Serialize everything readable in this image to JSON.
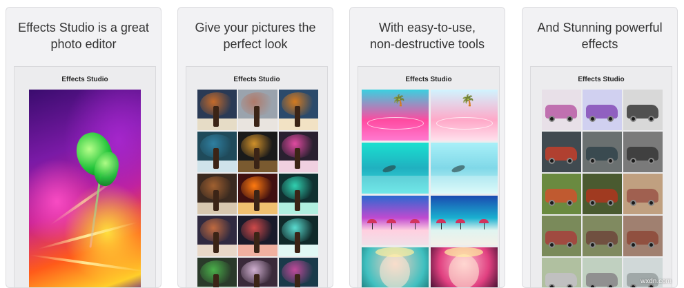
{
  "cards": [
    {
      "caption_lines": [
        "Effects Studio is a great",
        "photo editor"
      ],
      "app_title": "Effects Studio"
    },
    {
      "caption_lines": [
        "Give your pictures the",
        "perfect look"
      ],
      "app_title": "Effects Studio"
    },
    {
      "caption_lines": [
        "With easy-to-use,",
        "non-destructive tools"
      ],
      "app_title": "Effects Studio"
    },
    {
      "caption_lines": [
        "And Stunning powerful",
        "effects"
      ],
      "app_title": "Effects Studio"
    }
  ],
  "watermark": "wxdn.com",
  "colors": {
    "card_bg": "#f2f2f4",
    "caption_text": "#333333",
    "app_title_text": "#222222"
  },
  "screens": {
    "card1": "wallpaper-flower-bud",
    "card2": "tree-photo-filter-grid",
    "card3": "beach-photo-filter-grid",
    "card4": "vintage-car-filter-grid"
  }
}
